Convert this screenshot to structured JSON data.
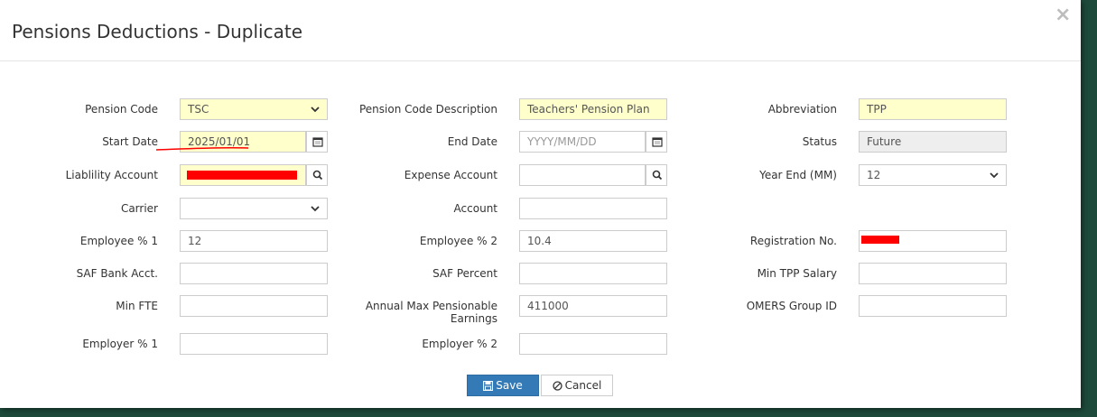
{
  "dialog": {
    "title": "Pensions Deductions - Duplicate",
    "close_label": "×"
  },
  "form": {
    "pension_code": {
      "label": "Pension Code",
      "value": "TSC"
    },
    "pension_code_description": {
      "label": "Pension Code Description",
      "value": "Teachers' Pension Plan"
    },
    "abbreviation": {
      "label": "Abbreviation",
      "value": "TPP"
    },
    "start_date": {
      "label": "Start Date",
      "value": "2025/01/01"
    },
    "end_date": {
      "label": "End Date",
      "placeholder": "YYYY/MM/DD"
    },
    "status": {
      "label": "Status",
      "value": "Future"
    },
    "liability_account": {
      "label": "Liablility Account"
    },
    "expense_account": {
      "label": "Expense Account",
      "value": ""
    },
    "year_end": {
      "label": "Year End (MM)",
      "value": "12"
    },
    "carrier": {
      "label": "Carrier",
      "value": ""
    },
    "account": {
      "label": "Account",
      "value": ""
    },
    "employee_pct_1": {
      "label": "Employee % 1",
      "value": "12"
    },
    "employee_pct_2": {
      "label": "Employee % 2",
      "value": "10.4"
    },
    "registration_no": {
      "label": "Registration No."
    },
    "saf_bank_acct": {
      "label": "SAF Bank Acct.",
      "value": ""
    },
    "saf_percent": {
      "label": "SAF Percent",
      "value": ""
    },
    "min_tpp_salary": {
      "label": "Min TPP Salary",
      "value": ""
    },
    "min_fte": {
      "label": "Min FTE",
      "value": ""
    },
    "annual_max_pensionable_earnings": {
      "label_line1": "Annual Max Pensionable",
      "label_line2": "Earnings",
      "value": "411000"
    },
    "omers_group_id": {
      "label": "OMERS Group ID",
      "value": ""
    },
    "employer_pct_1": {
      "label": "Employer % 1",
      "value": ""
    },
    "employer_pct_2": {
      "label": "Employer % 2",
      "value": ""
    }
  },
  "buttons": {
    "save": "Save",
    "cancel": "Cancel"
  },
  "colors": {
    "required_bg": "#ffffcc",
    "readonly_bg": "#eeeeee",
    "primary": "#337ab7",
    "redaction": "#ff0000",
    "annotation_line": "#ff0000"
  }
}
